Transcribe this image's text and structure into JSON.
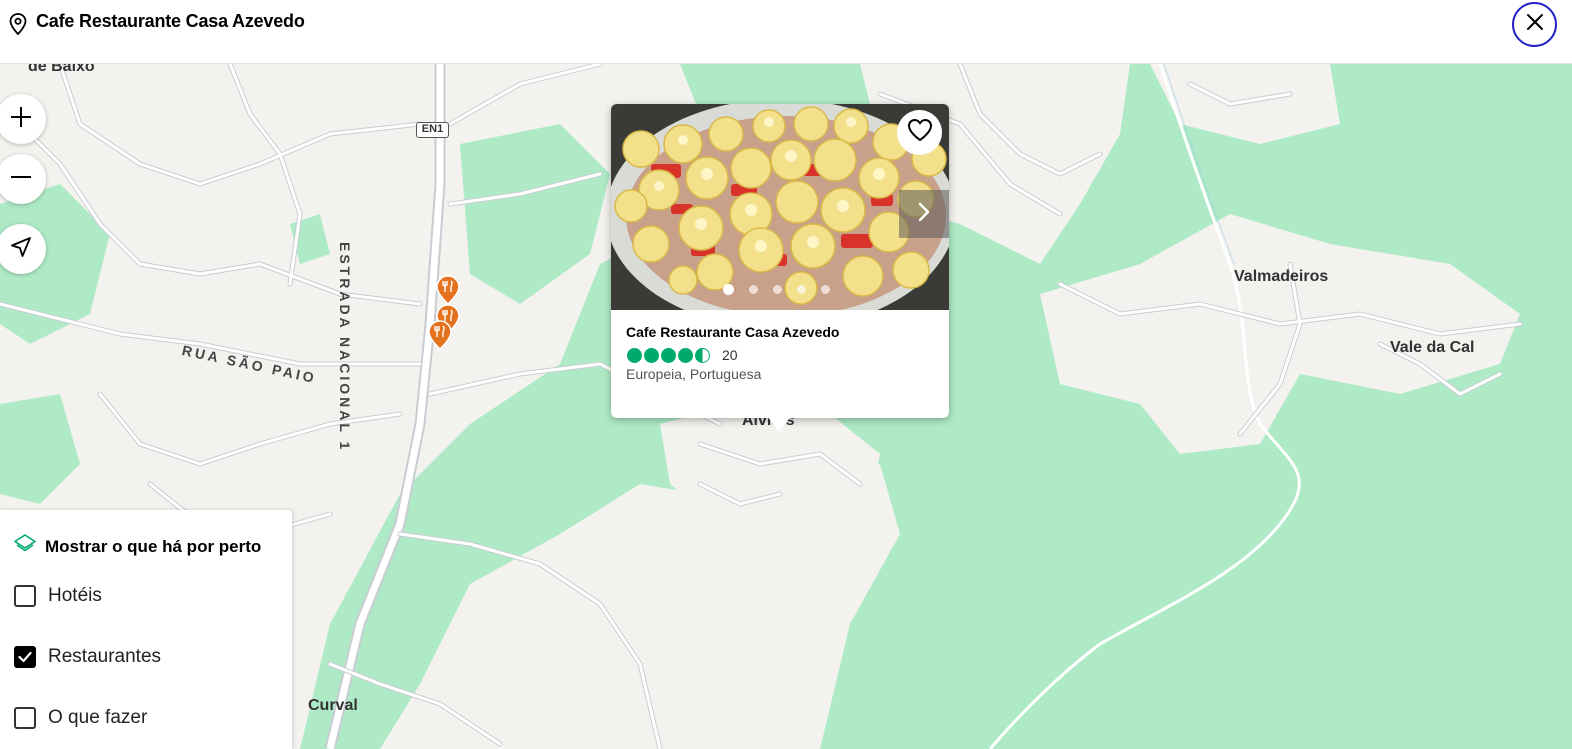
{
  "header": {
    "title": "Cafe Restaurante Casa Azevedo",
    "close_label": "Fechar"
  },
  "map": {
    "labels": {
      "de_baixo": "de Baixo",
      "en1": "EN1",
      "estrada": "ESTRADA NACIONAL 1",
      "rua_sao_paio": "RUA SÃO PAIO",
      "valmadeiros": "Valmadeiros",
      "vale_da_cal": "Vale da Cal",
      "alvites": "Alvites",
      "curval": "Curval"
    },
    "colors": {
      "green": "#aeeac6",
      "road": "#ffffff",
      "road_edge": "#c8cdd4",
      "land": "#f4f2ee",
      "marker": "#e4721f"
    }
  },
  "controls": {
    "zoom_in": "plus-icon",
    "zoom_out": "minus-icon",
    "locate": "navigation-arrow-icon"
  },
  "card": {
    "name": "Cafe Restaurante Casa Azevedo",
    "rating": 4.5,
    "review_count": "20",
    "cuisine": "Europeia, Portuguesa",
    "photo_count": 5,
    "active_photo": 1,
    "rating_color": "#00aa6c"
  },
  "nearby": {
    "title": "Mostrar o que há por perto",
    "options": [
      {
        "label": "Hotéis",
        "checked": false
      },
      {
        "label": "Restaurantes",
        "checked": true
      },
      {
        "label": "O que fazer",
        "checked": false
      }
    ]
  }
}
